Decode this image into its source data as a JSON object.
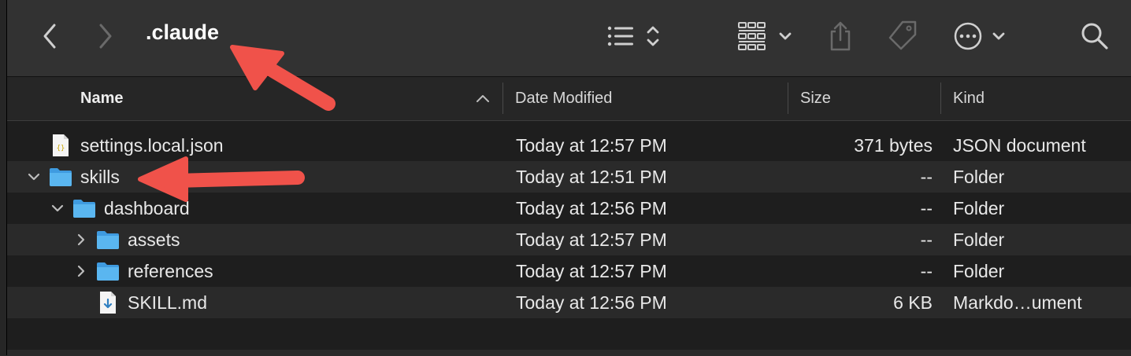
{
  "window": {
    "title": ".claude"
  },
  "toolbar": {
    "icons": [
      "chevron-left-icon",
      "chevron-right-icon",
      "list-view-icon",
      "group-view-icon",
      "share-icon",
      "tag-icon",
      "more-icon",
      "search-icon"
    ]
  },
  "columns": {
    "name": "Name",
    "date": "Date Modified",
    "size": "Size",
    "kind": "Kind"
  },
  "rows": [
    {
      "name": "settings.local.json",
      "date": "Today at 12:57 PM",
      "size": "371 bytes",
      "kind": "JSON document",
      "icon": "json-file-icon",
      "depth": 0,
      "disclosure": "none"
    },
    {
      "name": "skills",
      "date": "Today at 12:51 PM",
      "size": "--",
      "kind": "Folder",
      "icon": "folder-icon",
      "depth": 0,
      "disclosure": "expanded"
    },
    {
      "name": "dashboard",
      "date": "Today at 12:56 PM",
      "size": "--",
      "kind": "Folder",
      "icon": "folder-icon",
      "depth": 1,
      "disclosure": "expanded"
    },
    {
      "name": "assets",
      "date": "Today at 12:57 PM",
      "size": "--",
      "kind": "Folder",
      "icon": "folder-icon",
      "depth": 2,
      "disclosure": "collapsed"
    },
    {
      "name": "references",
      "date": "Today at 12:57 PM",
      "size": "--",
      "kind": "Folder",
      "icon": "folder-icon",
      "depth": 2,
      "disclosure": "collapsed"
    },
    {
      "name": "SKILL.md",
      "date": "Today at 12:56 PM",
      "size": "6 KB",
      "kind": "Markdo…ument",
      "icon": "markdown-file-icon",
      "depth": 2,
      "disclosure": "none"
    }
  ],
  "colors": {
    "annotation_arrow": "#f0524a",
    "folder": "#4aa8e8"
  }
}
